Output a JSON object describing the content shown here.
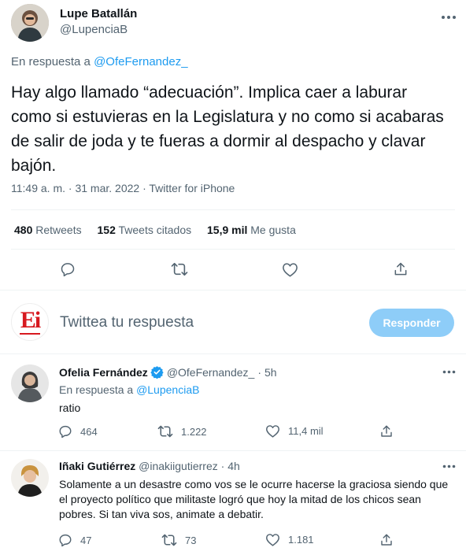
{
  "main_tweet": {
    "author_name": "Lupe Batallán",
    "author_handle": "@LupenciaB",
    "reply_prefix": "En respuesta a",
    "reply_to": "@OfeFernandez_",
    "text": "Hay algo llamado “adecuación”. Implica caer a laburar como si estuvieras en la Legislatura y no como si acabaras de salir de joda y te fueras a dormir al despacho y clavar bajón.",
    "time": "11:49 a. m.",
    "sep": "·",
    "date": "31 mar. 2022",
    "source": "Twitter for iPhone",
    "stats": {
      "retweets_count": "480",
      "retweets_label": "Retweets",
      "quotes_count": "152",
      "quotes_label": "Tweets citados",
      "likes_count": "15,9 mil",
      "likes_label": "Me gusta"
    }
  },
  "composer": {
    "logo_text": "Ei",
    "placeholder": "Twittea tu respuesta",
    "button_label": "Responder"
  },
  "replies": [
    {
      "author_name": "Ofelia Fernández",
      "verified": true,
      "author_handle": "@OfeFernandez_",
      "sep": "·",
      "time": "5h",
      "reply_prefix": "En respuesta a",
      "reply_to": "@LupenciaB",
      "text": "ratio",
      "reply_count": "464",
      "retweet_count": "1.222",
      "like_count": "11,4 mil"
    },
    {
      "author_name": "Iñaki Gutiérrez",
      "verified": false,
      "author_handle": "@inakiigutierrez",
      "sep": "·",
      "time": "4h",
      "text": "Solamente a un desastre como vos se le ocurre hacerse la graciosa siendo que el proyecto político que militaste logró que hoy la mitad de los chicos sean pobres. Si tan viva sos, animate a debatir.",
      "reply_count": "47",
      "retweet_count": "73",
      "like_count": "1.181"
    }
  ],
  "colors": {
    "accent": "#1d9bf0",
    "button_disabled": "#8ecdf8",
    "brand_red": "#d7191f",
    "verified": "#1d9bf0"
  }
}
